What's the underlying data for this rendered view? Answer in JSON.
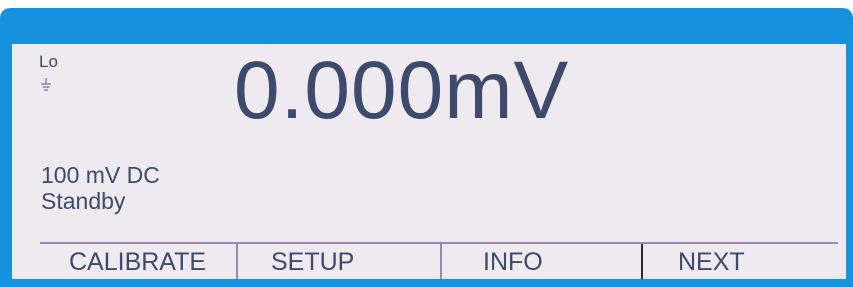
{
  "display": {
    "input_terminal": "Lo",
    "reading": "0.000mV",
    "range": "100 mV DC",
    "status": "Standby"
  },
  "icons": {
    "ground": "ground-icon"
  },
  "softkeys": [
    {
      "label": "CALIBRATE"
    },
    {
      "label": "SETUP"
    },
    {
      "label": "INFO"
    },
    {
      "label": "NEXT"
    }
  ],
  "colors": {
    "bezel": "#1691dd",
    "screen": "#efeaf0",
    "text": "#3d4a6b",
    "divider": "#9a87b8"
  }
}
